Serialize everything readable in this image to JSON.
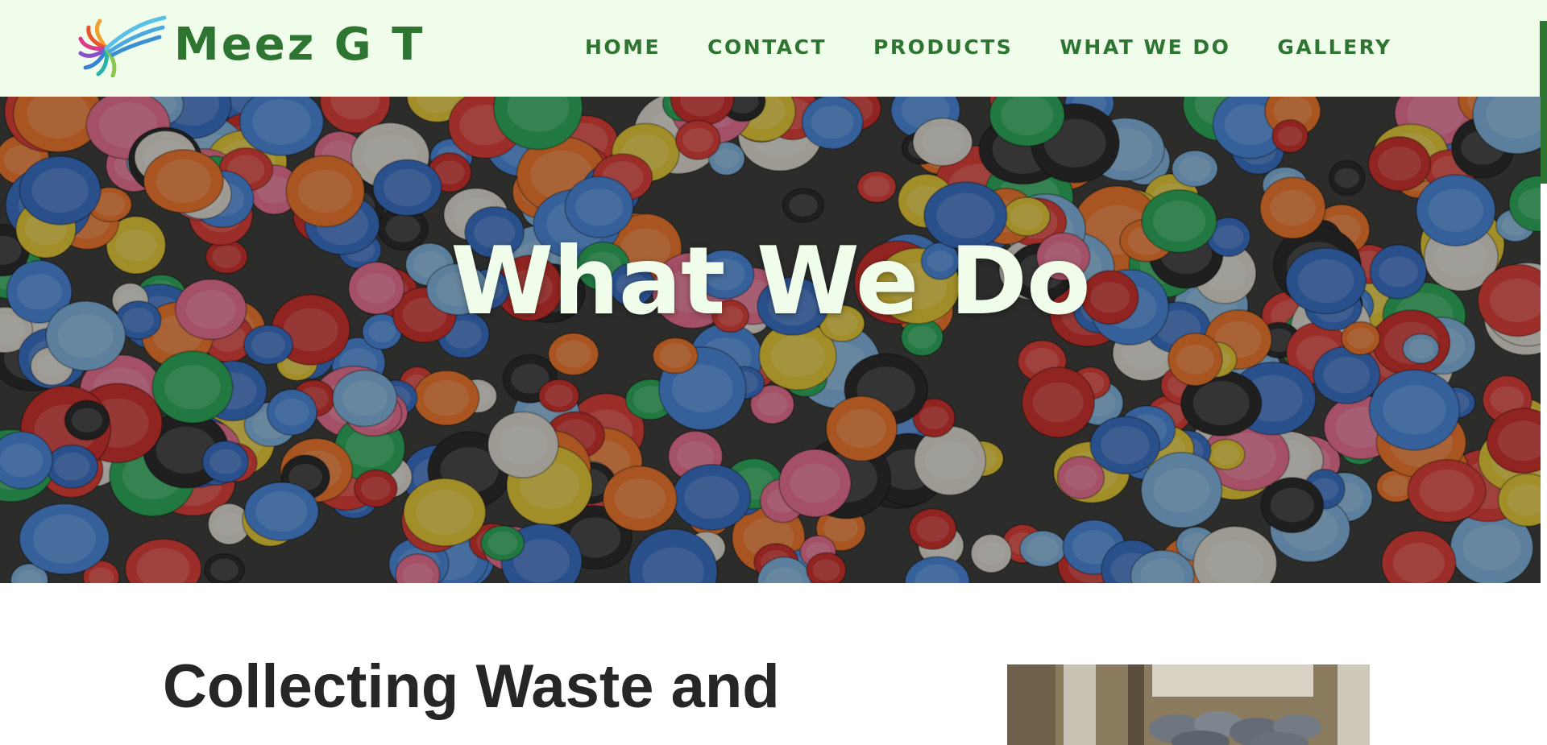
{
  "brand": {
    "name": "Meez G T",
    "logo_icon": "swirl-bird-logo-icon"
  },
  "nav": {
    "items": [
      {
        "label": "HOME"
      },
      {
        "label": "CONTACT"
      },
      {
        "label": "PRODUCTS"
      },
      {
        "label": "WHAT WE DO"
      },
      {
        "label": "GALLERY"
      }
    ]
  },
  "hero": {
    "title": "What We Do",
    "image": "colorful-plastic-bottle-caps-photo"
  },
  "content": {
    "heading": "Collecting Waste and",
    "image": "waste-sacks-storage-photo"
  },
  "colors": {
    "brand_green": "#2e7532",
    "header_bg": "#effdea",
    "hero_title": "#effdea",
    "heading_text": "#262626"
  }
}
